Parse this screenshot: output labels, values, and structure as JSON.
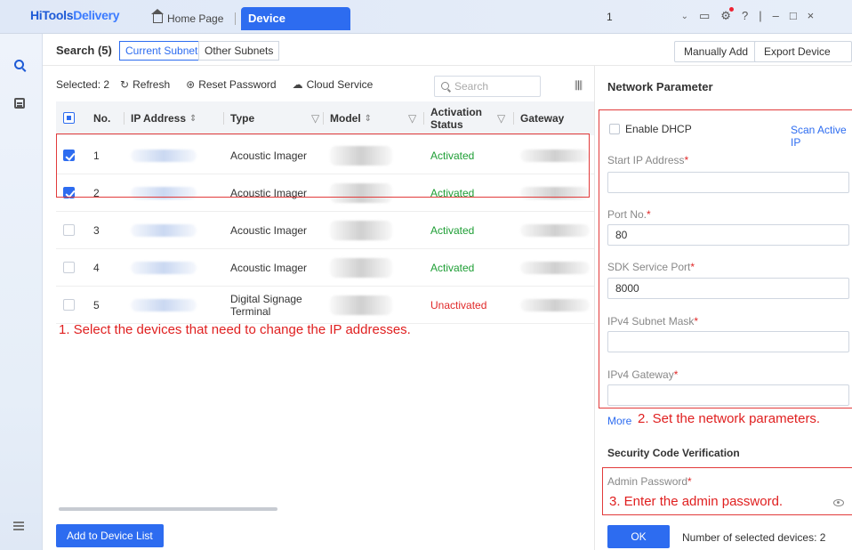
{
  "app": {
    "logo_a": "HiTools",
    "logo_b": "Delivery"
  },
  "tabs": {
    "home": "Home Page",
    "active": "Device Management",
    "close": "×"
  },
  "user_select": {
    "value": "1",
    "chevron": "⌄"
  },
  "window_icons": {
    "calendar": "▭",
    "settings": "⚙",
    "help": "?",
    "divider": "|",
    "minimize": "–",
    "maximize": "□",
    "close": "×"
  },
  "topbar": {
    "search_label": "Search (5)",
    "seg_current": "Current Subnet",
    "seg_other": "Other Subnets",
    "manual_add": "Manually Add",
    "export": "Export Device List"
  },
  "toolbar": {
    "selected": "Selected: 2",
    "refresh": "Refresh",
    "reset_password": "Reset Password",
    "cloud_service": "Cloud Service",
    "search_placeholder": "Search"
  },
  "table": {
    "headers": {
      "no": "No.",
      "ip": "IP Address",
      "type": "Type",
      "model": "Model",
      "activation_line1": "Activation",
      "activation_line2": "Status",
      "gateway": "Gateway"
    },
    "rows": [
      {
        "no": "1",
        "type": "Acoustic Imager",
        "type2": "",
        "status": "Activated",
        "checked": true
      },
      {
        "no": "2",
        "type": "Acoustic Imager",
        "type2": "",
        "status": "Activated",
        "checked": true
      },
      {
        "no": "3",
        "type": "Acoustic Imager",
        "type2": "",
        "status": "Activated",
        "checked": false
      },
      {
        "no": "4",
        "type": "Acoustic Imager",
        "type2": "",
        "status": "Activated",
        "checked": false
      },
      {
        "no": "5",
        "type": "Digital Signage",
        "type2": "Terminal",
        "status": "Unactivated",
        "checked": false
      }
    ]
  },
  "annotations": {
    "step1": "1. Select the devices that need to change the IP addresses.",
    "step2": "2. Set the network parameters.",
    "step3": "3. Enter the admin password."
  },
  "add_button": "Add to Device List",
  "network": {
    "title": "Network Parameter",
    "enable_dhcp": "Enable DHCP",
    "scan": "Scan Active IP",
    "start_ip_label": "Start IP Address",
    "port_label": "Port No.",
    "port_value": "80",
    "sdk_label": "SDK Service Port",
    "sdk_value": "8000",
    "mask_label": "IPv4 Subnet Mask",
    "gateway_label": "IPv4 Gateway",
    "more": "More",
    "security_title": "Security Code Verification",
    "admin_label": "Admin Password",
    "required_mark": "*",
    "ok": "OK",
    "selected_count": "Number of selected devices: 2"
  },
  "colors": {
    "accent": "#2d6cf0",
    "activated": "#1e9e35",
    "unactivated": "#e02828",
    "annotation": "#e02020"
  }
}
